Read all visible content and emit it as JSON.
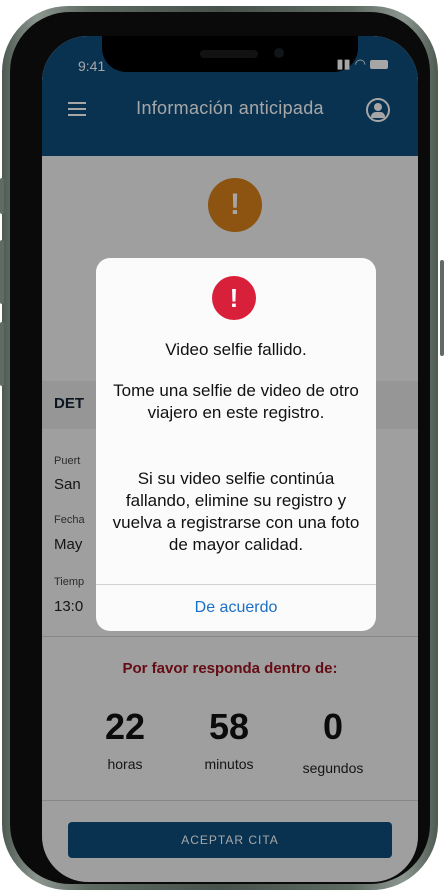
{
  "status": {
    "time": "9:41"
  },
  "header": {
    "title": "Información anticipada"
  },
  "details": {
    "heading": "DET",
    "rows": [
      {
        "label": "Puert",
        "value": "San"
      },
      {
        "label": "Fecha",
        "value": "May"
      },
      {
        "label": "Tiemp",
        "value": "13:0"
      }
    ]
  },
  "countdown": {
    "prompt": "Por favor responda dentro de:",
    "hours": "22",
    "hours_label": "horas",
    "minutes": "58",
    "minutes_label": "minutos",
    "seconds": "0",
    "seconds_label": "segundos"
  },
  "accept_button": "ACEPTAR CITA",
  "alert": {
    "icon": "!",
    "title": "Video selfie fallido.",
    "body1": "Tome una selfie de video de otro viajero en este registro.",
    "body2": "Si su video selfie continúa fallando, elimine su registro y vuelva a registrarse con una foto de mayor calidad.",
    "button": "De acuerdo"
  },
  "icons": [
    "menu-icon",
    "profile-icon",
    "warning-icon",
    "error-icon",
    "signal-icon",
    "wifi-icon",
    "battery-icon"
  ],
  "colors": {
    "brand": "#0f4d7c",
    "warning": "#d9801a",
    "error": "#d8203a",
    "link": "#1b6fc4",
    "prompt": "#9b1320"
  }
}
